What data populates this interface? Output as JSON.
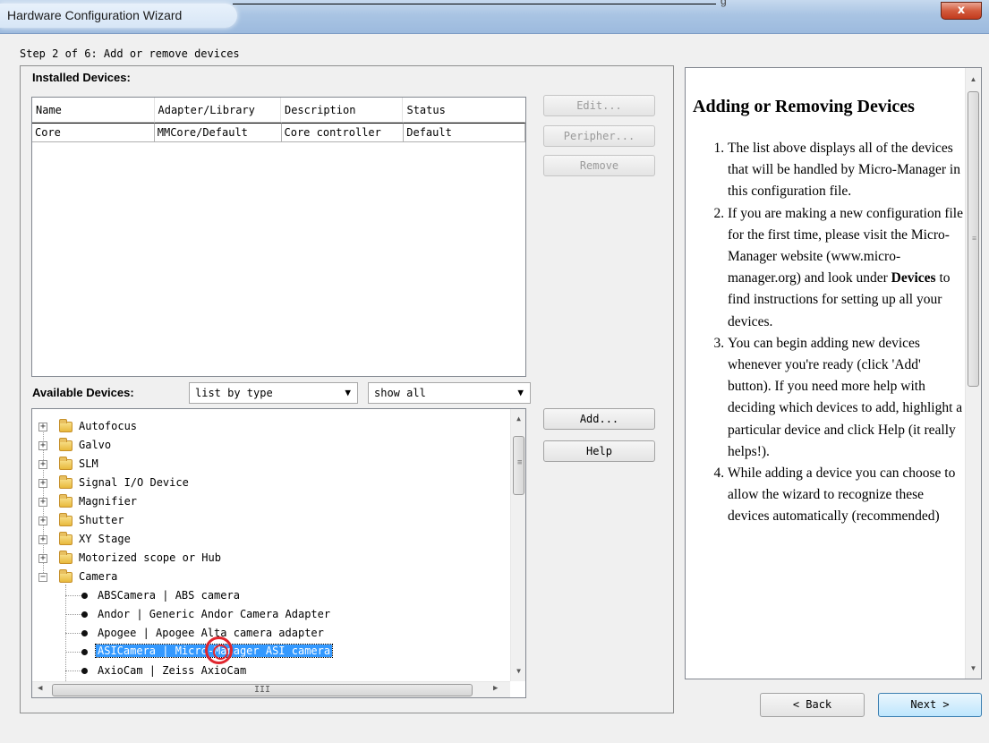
{
  "window": {
    "title": "Hardware Configuration Wizard",
    "top_edge_fragment": "g",
    "close_label": "x"
  },
  "step_label": "Step 2 of 6: Add or remove devices",
  "installed": {
    "label": "Installed Devices:",
    "columns": [
      "Name",
      "Adapter/Library",
      "Description",
      "Status"
    ],
    "rows": [
      {
        "name": "Core",
        "adapter": "MMCore/Default",
        "description": "Core controller",
        "status": "Default"
      }
    ]
  },
  "side_buttons": {
    "edit": "Edit...",
    "peripherals": "Peripher...",
    "remove": "Remove",
    "add": "Add...",
    "help": "Help"
  },
  "available": {
    "label": "Available Devices:",
    "list_mode": "list by type",
    "filter": "show all",
    "categories": [
      "Autofocus",
      "Galvo",
      "SLM",
      "Signal I/O Device",
      "Magnifier",
      "Shutter",
      "XY Stage",
      "Motorized scope or Hub",
      "Camera"
    ],
    "camera_items": [
      "ABSCamera | ABS camera",
      "Andor | Generic Andor Camera Adapter",
      "Apogee | Apogee Alta camera adapter",
      "ASICamera | Micro-Manager ASI camera",
      "AxioCam | Zeiss AxioCam"
    ],
    "selected_item_index": 3,
    "hscroll_grip": "III"
  },
  "help": {
    "title": "Adding or Removing Devices",
    "items": [
      {
        "pre": "The list above displays all of the devices that will be handled by Micro-Manager in this configuration file.",
        "bold": "",
        "post": ""
      },
      {
        "pre": "If you are making a new configuration file for the first time, please visit the Micro-Manager website (www.micro-manager.org) and look under ",
        "bold": "Devices",
        "post": " to find instructions for setting up all your devices."
      },
      {
        "pre": "You can begin adding new devices whenever you're ready (click 'Add' button). If you need more help with deciding which devices to add, highlight a particular device and click Help (it really helps!).",
        "bold": "",
        "post": ""
      },
      {
        "pre": "While adding a device you can choose to allow the wizard to recognize these devices automatically (recommended)",
        "bold": "",
        "post": ""
      }
    ]
  },
  "nav": {
    "back": "< Back",
    "next": "Next >"
  },
  "colors": {
    "selection": "#3399ff",
    "annotation": "#e0262e"
  }
}
